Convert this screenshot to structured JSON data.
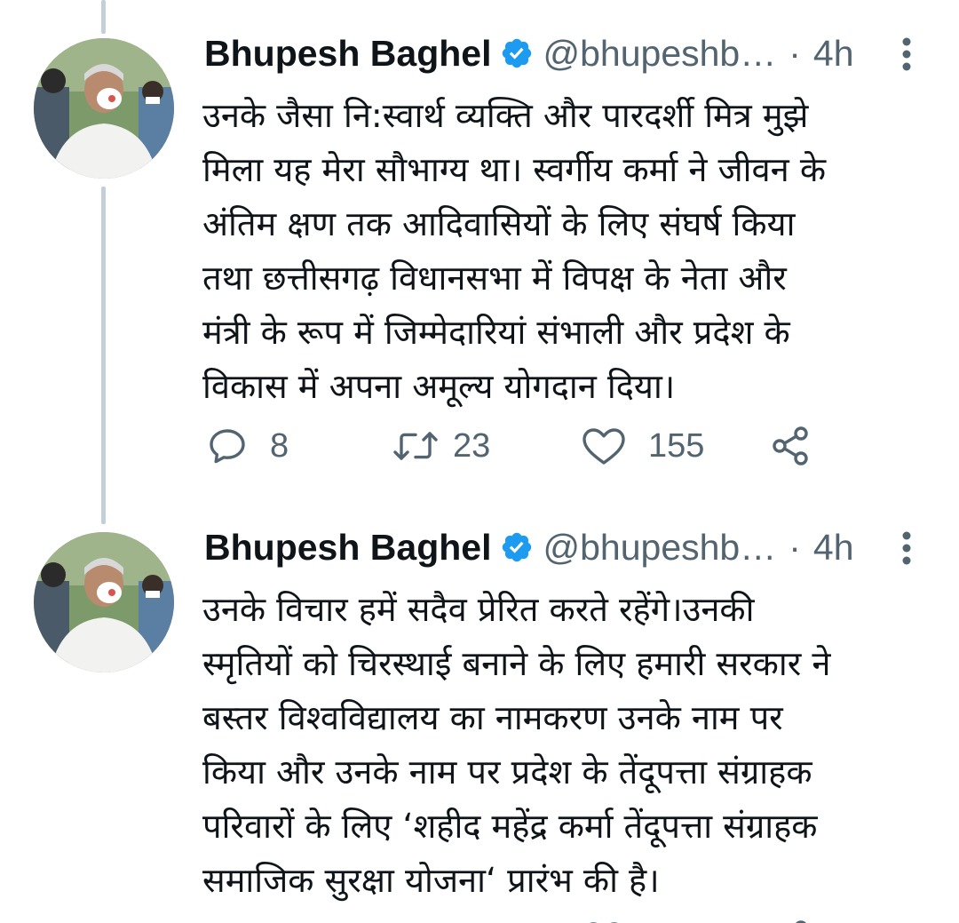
{
  "tweets": [
    {
      "author": "Bhupesh Baghel",
      "handle": "@bhupeshb…",
      "separator": "·",
      "time": "4h",
      "text": "उनके जैसा नि:स्वार्थ व्यक्ति और पारदर्शी मित्र मुझे\nमिला यह मेरा सौभाग्य था। स्वर्गीय कर्मा ने जीवन के\nअंतिम क्षण तक आदिवासियों के लिए संघर्ष किया\nतथा छत्तीसगढ़ विधानसभा में विपक्ष के नेता और\nमंत्री के रूप में जिम्मेदारियां संभाली और प्रदेश के\nविकास में अपना अमूल्य योगदान दिया।",
      "replies": "8",
      "retweets": "23",
      "likes": "155"
    },
    {
      "author": "Bhupesh Baghel",
      "handle": "@bhupeshb…",
      "separator": "·",
      "time": "4h",
      "text": "उनके विचार हमें सदैव प्रेरित करते रहेंगे।उनकी\nस्मृतियों को चिरस्थाई बनाने के लिए हमारी सरकार ने\nबस्तर विश्वविद्यालय का नामकरण उनके नाम पर\nकिया और उनके नाम पर प्रदेश के तेंदूपत्ता संग्राहक\nपरिवारों के लिए ‘शहीद महेंद्र कर्मा तेंदूपत्ता संग्राहक\nसमाजिक सुरक्षा योजना‘ प्रारंभ की है।"
    }
  ],
  "colors": {
    "text": "#0f1419",
    "secondary": "#536471",
    "verified": "#1d9bf0",
    "thread_line": "#c4cfd6"
  },
  "icons": {
    "verified": "verified-badge-icon",
    "more": "more-vertical-icon",
    "reply": "reply-bubble-icon",
    "retweet": "retweet-icon",
    "like": "heart-icon",
    "share": "share-icon"
  }
}
